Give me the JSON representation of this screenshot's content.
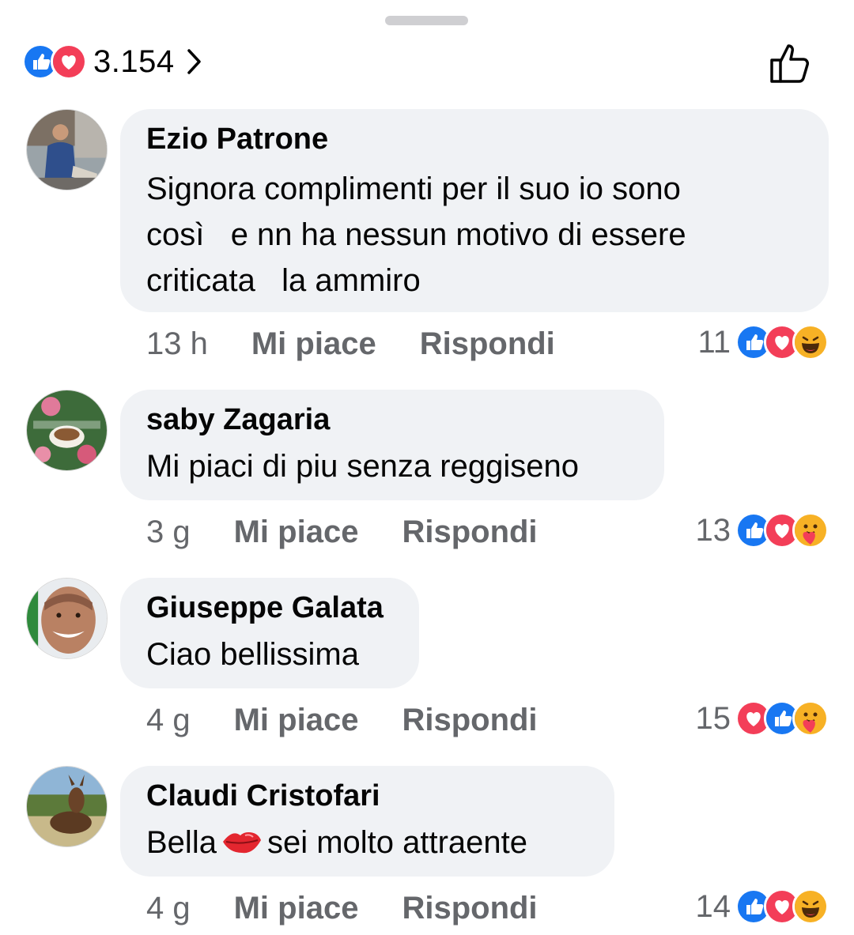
{
  "header": {
    "total_reactions": "3.154"
  },
  "colors": {
    "like_blue": "#1877f2",
    "love_red": "#f33e58",
    "bubble_bg": "#f0f2f5",
    "meta_gray": "#65676b",
    "text": "#050505"
  },
  "comments": [
    {
      "author": "Ezio Patrone",
      "text": "Signora complimenti per il suo io sono\ncosì   e nn ha nessun motivo di essere\ncriticata   la ammiro",
      "time": "13 h",
      "like_label": "Mi piace",
      "reply_label": "Rispondi",
      "reaction_count": "11",
      "reactions": [
        "like-icon",
        "love-icon",
        "haha-icon"
      ]
    },
    {
      "author": "saby Zagaria",
      "text": "Mi piaci di piu senza reggiseno",
      "time": "3 g",
      "like_label": "Mi piace",
      "reply_label": "Rispondi",
      "reaction_count": "13",
      "reactions": [
        "like-icon",
        "love-icon",
        "care-icon"
      ]
    },
    {
      "author": "Giuseppe Galata",
      "text": "Ciao bellissima",
      "time": "4 g",
      "like_label": "Mi piace",
      "reply_label": "Rispondi",
      "reaction_count": "15",
      "reactions": [
        "love-icon",
        "like-icon",
        "care-icon"
      ]
    },
    {
      "author": "Claudi Cristofari",
      "text_before": "Bella",
      "text_emoji": "kiss-lips-icon",
      "text_after": "sei molto attraente",
      "time": "4 g",
      "like_label": "Mi piace",
      "reply_label": "Rispondi",
      "reaction_count": "14",
      "reactions": [
        "like-icon",
        "love-icon",
        "haha-icon"
      ]
    }
  ]
}
